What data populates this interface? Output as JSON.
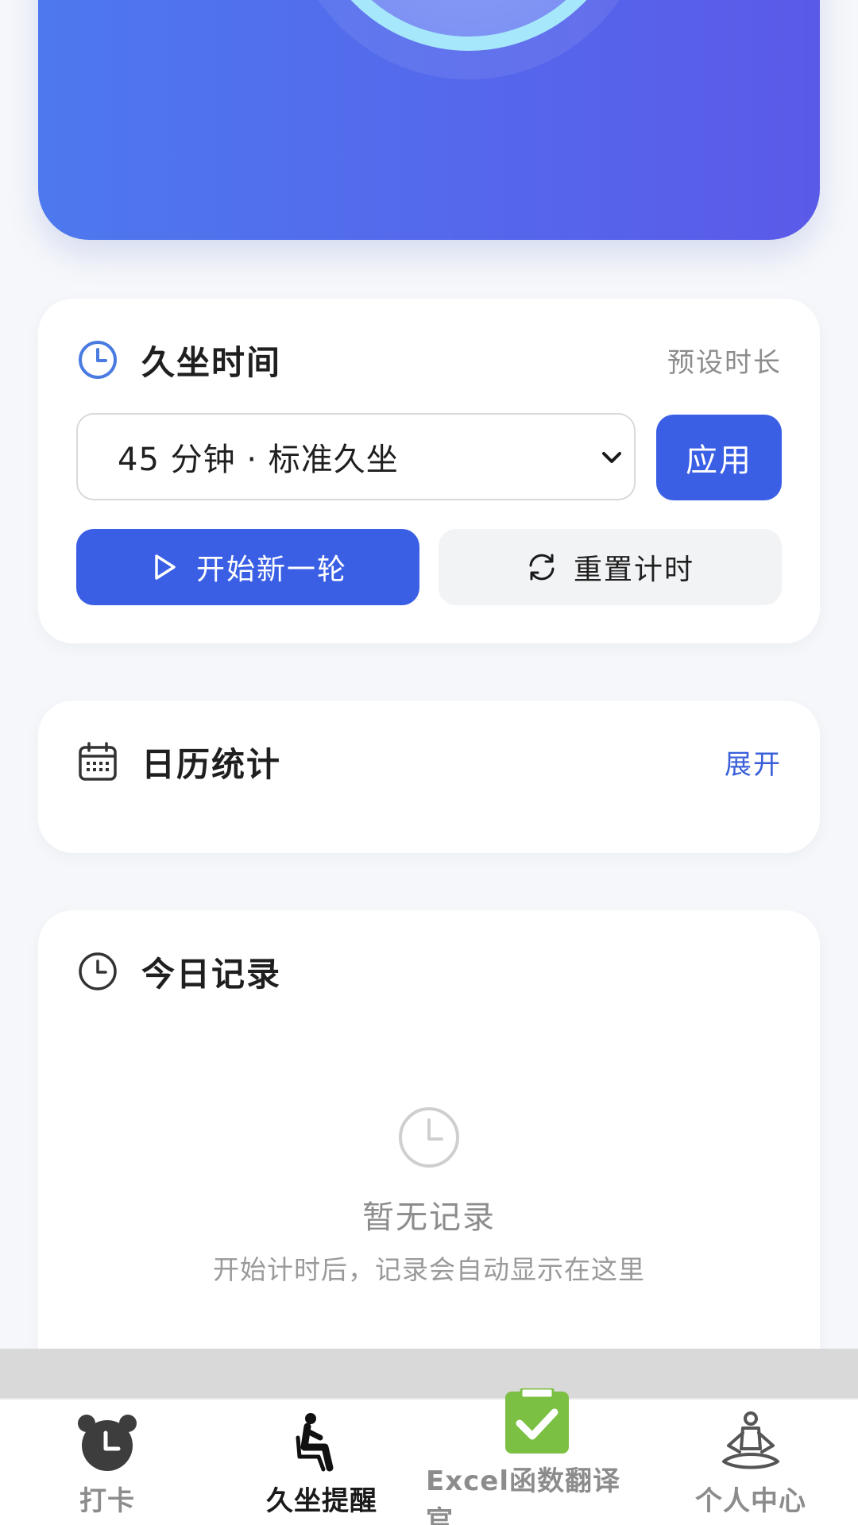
{
  "colors": {
    "primary": "#3a5fe5",
    "link": "#3a5fd8",
    "hero_start": "#4d78ee",
    "hero_end": "#5a5ae8",
    "ring": "#a6e7fb",
    "excel_green": "#7bc043"
  },
  "sitting_card": {
    "title": "久坐时间",
    "aside": "预设时长",
    "icon": "clock-icon",
    "select_value": "45 分钟 · 标准久坐",
    "apply_label": "应用",
    "start_label": "开始新一轮",
    "reset_label": "重置计时"
  },
  "calendar_card": {
    "title": "日历统计",
    "icon": "calendar-icon",
    "expand_label": "展开"
  },
  "records_card": {
    "title": "今日记录",
    "icon": "clock-icon",
    "empty_title": "暂无记录",
    "empty_subtitle": "开始计时后，记录会自动显示在这里"
  },
  "tabbar": {
    "items": [
      {
        "label": "打卡",
        "icon": "alarm-clock-icon",
        "active": false
      },
      {
        "label": "久坐提醒",
        "icon": "sitting-person-icon",
        "active": true
      },
      {
        "label": "Excel函数翻译官",
        "icon": "clipboard-check-icon",
        "active": false
      },
      {
        "label": "个人中心",
        "icon": "meditation-icon",
        "active": false
      }
    ]
  }
}
